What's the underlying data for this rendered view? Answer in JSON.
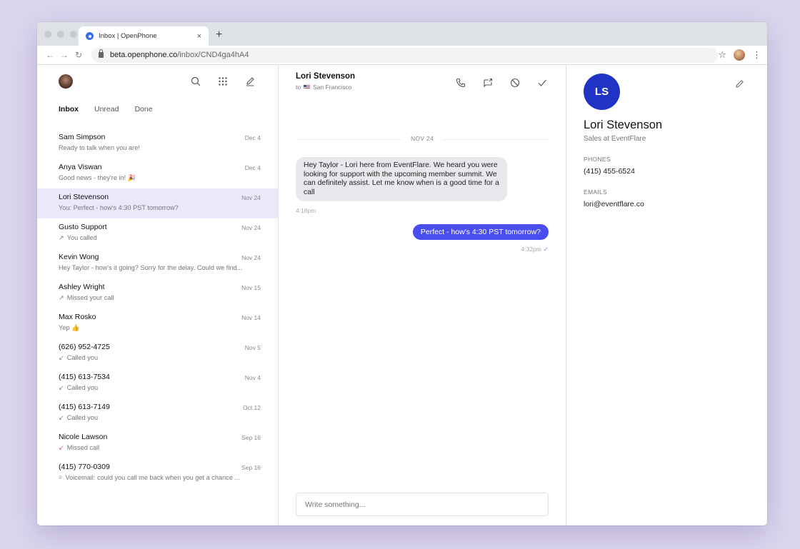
{
  "browser": {
    "tab_title": "Inbox | OpenPhone",
    "tab_close": "×",
    "new_tab": "+",
    "url_host": "beta.openphone.co",
    "url_path": "/inbox/CND4ga4hA4"
  },
  "sidebar": {
    "filters": [
      "Inbox",
      "Unread",
      "Done"
    ],
    "conversations": [
      {
        "name": "Sam Simpson",
        "date": "Dec 4",
        "icon": "",
        "preview": "Ready to talk when you are!"
      },
      {
        "name": "Anya Viswan",
        "date": "Dec 4",
        "icon": "",
        "preview": "Good news - they're in! 🎉"
      },
      {
        "name": "Lori Stevenson",
        "date": "Nov 24",
        "icon": "",
        "preview": "You: Perfect - how's 4:30 PST tomorrow?"
      },
      {
        "name": "Gusto Support",
        "date": "Nov 24",
        "icon": "↗",
        "preview": "You called"
      },
      {
        "name": "Kevin Wong",
        "date": "Nov 24",
        "icon": "",
        "preview": "Hey Taylor - how's it going? Sorry for the delay. Could we find..."
      },
      {
        "name": "Ashley Wright",
        "date": "Nov 15",
        "icon": "↗",
        "preview": "Missed your call"
      },
      {
        "name": "Max Rosko",
        "date": "Nov 14",
        "icon": "",
        "preview": "Yep 👍"
      },
      {
        "name": "(626) 952-4725",
        "date": "Nov 5",
        "icon": "↙",
        "preview": "Called you"
      },
      {
        "name": "(415) 613-7534",
        "date": "Nov 4",
        "icon": "↙",
        "preview": "Called you"
      },
      {
        "name": "(415) 613-7149",
        "date": "Oct 12",
        "icon": "↙",
        "preview": "Called you"
      },
      {
        "name": "Nicole Lawson",
        "date": "Sep 16",
        "icon": "↙",
        "preview": "Missed call"
      },
      {
        "name": "(415) 770-0309",
        "date": "Sep 16",
        "icon": "⌾",
        "preview": "Voicemail: could you call me back when you get a chance ..."
      }
    ]
  },
  "chat": {
    "contact_name": "Lori Stevenson",
    "to_prefix": "to",
    "location": "San Francisco",
    "date_divider": "NOV 24",
    "incoming_message": "Hey Taylor - Lori here from EventFlare. We heard you were looking for support with the upcoming member summit. We can definitely assist. Let me know when is a good time for a call",
    "incoming_time": "4:18pm",
    "outgoing_message": "Perfect - how's 4:30 PST tomorrow?",
    "outgoing_time": "4:32pm",
    "outgoing_tick": "✓",
    "composer_placeholder": "Write something..."
  },
  "contact": {
    "initials": "LS",
    "name": "Lori Stevenson",
    "title": "Sales at EventFlare",
    "phones_label": "PHONES",
    "phone": "(415) 455-6524",
    "emails_label": "EMAILS",
    "email": "lori@eventflare.co"
  },
  "colors": {
    "accent": "#4a4ef0",
    "avatar_bg": "#1f34c4",
    "selected_row": "#e9e9fb",
    "page_bg": "#dcd6ee"
  }
}
